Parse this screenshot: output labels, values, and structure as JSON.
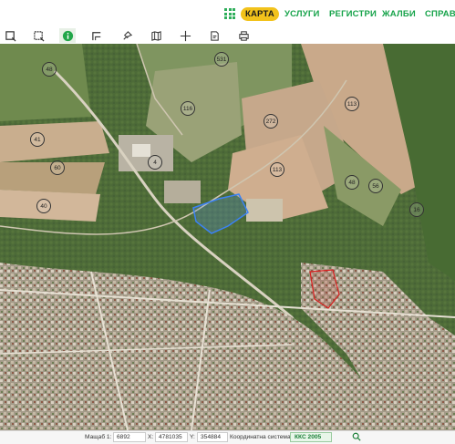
{
  "nav": {
    "apps_icon": "grid-icon",
    "items": [
      {
        "label": "КАРТА",
        "active": true
      },
      {
        "label": "УСЛУГИ"
      },
      {
        "label": "РЕГИСТРИ"
      },
      {
        "label": "ЖАЛБИ"
      },
      {
        "label": "СПРАВК"
      }
    ],
    "accent": "#16a34a",
    "active_bg": "#f2c21b"
  },
  "toolbar": {
    "tools": [
      "select-rect-icon",
      "select-poly-icon",
      "info-icon",
      "measure-icon",
      "pin-icon",
      "map-layers-icon",
      "crosshair-icon",
      "document-icon",
      "print-icon"
    ],
    "active_tool": "info-icon"
  },
  "map": {
    "parcel_labels": [
      "531",
      "116",
      "113",
      "272",
      "113",
      "41",
      "60",
      "48",
      "4",
      "40",
      "48",
      "16",
      "56"
    ],
    "highlight_color": "#3b82f6",
    "selection_color": "#d92020"
  },
  "status": {
    "scale_label": "Мащаб 1:",
    "scale_value": "6892",
    "x_label": "X:",
    "x_value": "4781035",
    "y_label": "Y:",
    "y_value": "354884",
    "crs_label": "Координатна система:",
    "crs_value": "ККС 2005"
  }
}
